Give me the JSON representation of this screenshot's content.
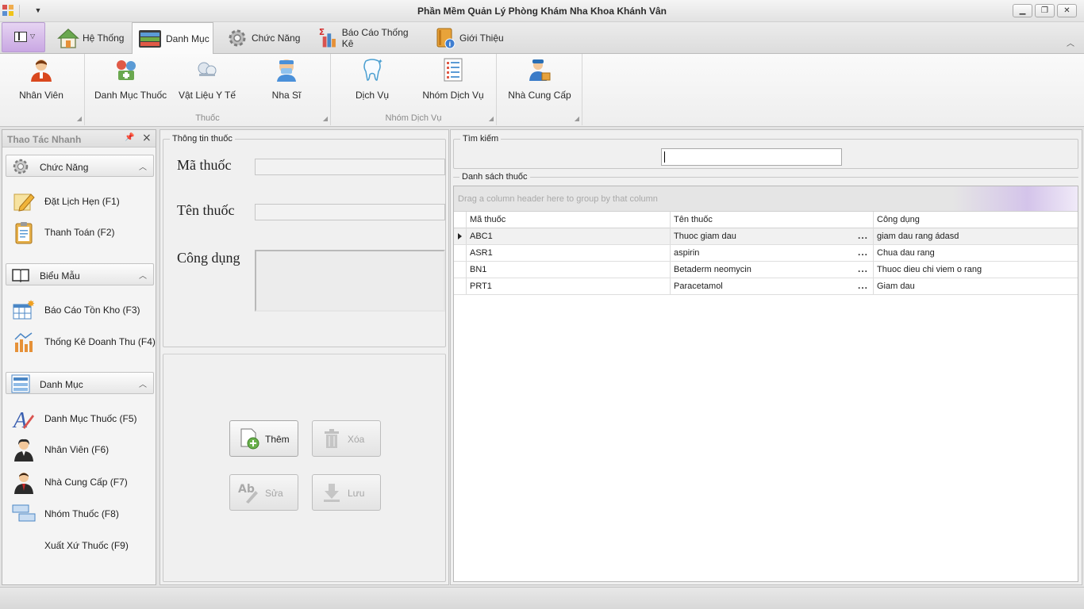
{
  "window": {
    "title": "Phần Mềm Quản Lý Phòng Khám Nha Khoa Khánh Vân",
    "minimize": "▁",
    "maximize": "❐",
    "close": "✕"
  },
  "ribbon": {
    "tabs": [
      {
        "label": "Hệ Thống",
        "icon": "house-icon"
      },
      {
        "label": "Danh Mục",
        "icon": "catalog-icon",
        "active": true
      },
      {
        "label": "Chức Năng",
        "icon": "gear-icon"
      },
      {
        "label": "Báo Cáo Thống Kê",
        "icon": "report-chart-icon"
      },
      {
        "label": "Giới Thiệu",
        "icon": "info-book-icon"
      }
    ],
    "groups": {
      "nhan_vien": {
        "label": "",
        "buttons": [
          {
            "label": "Nhân Viên",
            "icon": "employee-icon"
          }
        ]
      },
      "thuoc": {
        "label": "Thuốc",
        "buttons": [
          {
            "label": "Danh Mục Thuốc",
            "icon": "medicine-icon"
          },
          {
            "label": "Vật Liệu Y Tế",
            "icon": "medical-supplies-icon"
          },
          {
            "label": "Nha Sĩ",
            "icon": "dentist-icon"
          }
        ]
      },
      "nhom_dich_vu": {
        "label": "Nhóm Dịch Vụ",
        "buttons": [
          {
            "label": "Dịch Vụ",
            "icon": "tooth-icon"
          },
          {
            "label": "Nhóm Dịch Vụ",
            "icon": "checklist-icon"
          }
        ]
      },
      "nha_cung_cap": {
        "label": "",
        "buttons": [
          {
            "label": "Nhà Cung Cấp",
            "icon": "supplier-icon"
          }
        ]
      }
    }
  },
  "quick_panel": {
    "title": "Thao Tác Nhanh",
    "groups": [
      {
        "label": "Chức Năng",
        "icon": "gear-icon",
        "items": [
          {
            "label": "Đặt Lịch Hẹn  (F1)",
            "icon": "pencil-icon"
          },
          {
            "label": "Thanh Toán (F2)",
            "icon": "clipboard-icon"
          }
        ]
      },
      {
        "label": "Biểu Mẫu",
        "icon": "book-icon",
        "items": [
          {
            "label": "Báo Cáo Tồn Kho (F3)",
            "icon": "table-star-icon"
          },
          {
            "label": "Thống Kê Doanh Thu (F4)",
            "icon": "bar-chart-icon"
          }
        ]
      },
      {
        "label": "Danh Mục",
        "icon": "list-icon",
        "items": [
          {
            "label": "Danh Mục Thuốc (F5)",
            "icon": "letter-a-icon"
          },
          {
            "label": "Nhân Viên (F6)",
            "icon": "woman-employee-icon"
          },
          {
            "label": "Nhà Cung Cấp (F7)",
            "icon": "man-employee-icon"
          },
          {
            "label": "Nhóm Thuốc (F8)",
            "icon": "group-boxes-icon"
          },
          {
            "label": "Xuất Xứ Thuốc (F9)",
            "icon": ""
          }
        ]
      }
    ]
  },
  "medicine_info": {
    "title": "Thông tin thuốc",
    "fields": {
      "ma_thuoc": {
        "label": "Mã thuốc",
        "value": ""
      },
      "ten_thuoc": {
        "label": "Tên thuốc",
        "value": ""
      },
      "cong_dung": {
        "label": "Công dụng",
        "value": ""
      }
    },
    "buttons": {
      "them": "Thêm",
      "xoa": "Xóa",
      "sua": "Sửa",
      "luu": "Lưu"
    }
  },
  "search": {
    "title": "Tìm kiếm",
    "value": ""
  },
  "medicine_list": {
    "title": "Danh sách thuốc",
    "group_hint": "Drag a column header here to group by that column",
    "columns": [
      "Mã thuốc",
      "Tên thuốc",
      "Công dụng"
    ],
    "rows": [
      {
        "ma": "ABC1",
        "ten": "Thuoc giam dau",
        "cong_dung": "giam dau rang ádasd",
        "focused": true
      },
      {
        "ma": "ASR1",
        "ten": "aspirin",
        "cong_dung": "Chua dau rang"
      },
      {
        "ma": "BN1",
        "ten": "Betaderm neomycin",
        "cong_dung": "Thuoc dieu chi viem o rang"
      },
      {
        "ma": "PRT1",
        "ten": "Paracetamol",
        "cong_dung": "Giam dau"
      }
    ],
    "ellipsis": "..."
  },
  "colors": {
    "accent": "#c9a7e3",
    "chrome": "#e3e3e3"
  }
}
